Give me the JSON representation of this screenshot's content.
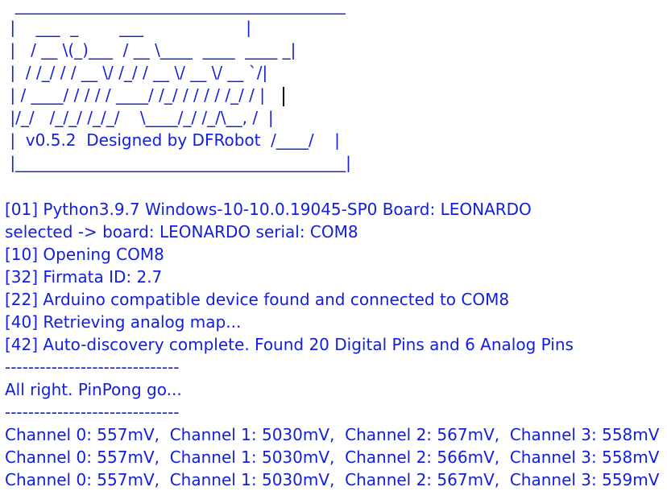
{
  "console": {
    "banner": [
      "  _________________________________________",
      " |    ___  _        ___                    |",
      " |   / __ \\(_)___  / __ \\____  ____  ____ _|",
      " |  / /_/ / / __ \\/ /_/ / __ \\/ __ \\/ __ `/|",
      " | / ____/ / / / / ____/ /_/ / / / / /_/ / |",
      " |/_/   /_/_/ /_/_/    \\____/_/ /_/\\__, /  |",
      " |  v0.5.2  Designed by DFRobot  /____/    |",
      " |_________________________________________|"
    ],
    "log": [
      "[01] Python3.9.7 Windows-10-10.0.19045-SP0 Board: LEONARDO",
      "selected -> board: LEONARDO serial: COM8",
      "[10] Opening COM8",
      "[32] Firmata ID: 2.7",
      "[22] Arduino compatible device found and connected to COM8",
      "[40] Retrieving analog map...",
      "[42] Auto-discovery complete. Found 20 Digital Pins and 6 Analog Pins",
      "------------------------------",
      "All right. PinPong go...",
      "------------------------------",
      "Channel 0: 557mV,  Channel 1: 5030mV,  Channel 2: 567mV,  Channel 3: 558mV",
      "Channel 0: 557mV,  Channel 1: 5030mV,  Channel 2: 566mV,  Channel 3: 558mV",
      "Channel 0: 557mV,  Channel 1: 5030mV,  Channel 2: 567mV,  Channel 3: 559mV"
    ],
    "text_color": "#1420d8",
    "background_color": "#ffffff"
  }
}
